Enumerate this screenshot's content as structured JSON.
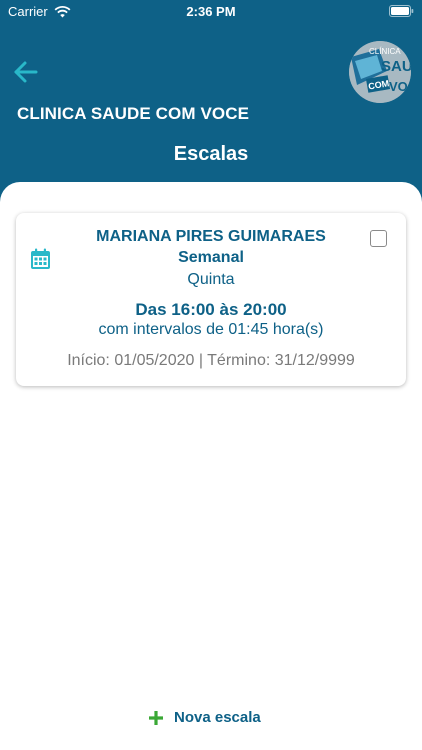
{
  "status_bar": {
    "carrier": "Carrier",
    "time": "2:36 PM"
  },
  "header": {
    "clinic_name": "CLINICA SAUDE COM VOCE",
    "title": "Escalas"
  },
  "logo": {
    "line1": "CLÍNICA",
    "line2": "SAUDE",
    "line3": "COM",
    "line4": "VOCE"
  },
  "card": {
    "name": "MARIANA PIRES GUIMARAES",
    "frequency": "Semanal",
    "weekday": "Quinta",
    "hours": "Das 16:00 às 20:00",
    "interval": "com intervalos de 01:45 hora(s)",
    "dates": "Início: 01/05/2020 | Término: 31/12/9999"
  },
  "footer": {
    "new_label": "Nova escala"
  },
  "colors": {
    "primary": "#0e6187",
    "accent": "#29b8c9",
    "add": "#3aa835"
  },
  "icons": {
    "back": "arrow-left-icon",
    "calendar": "calendar-icon",
    "add": "plus-icon"
  }
}
